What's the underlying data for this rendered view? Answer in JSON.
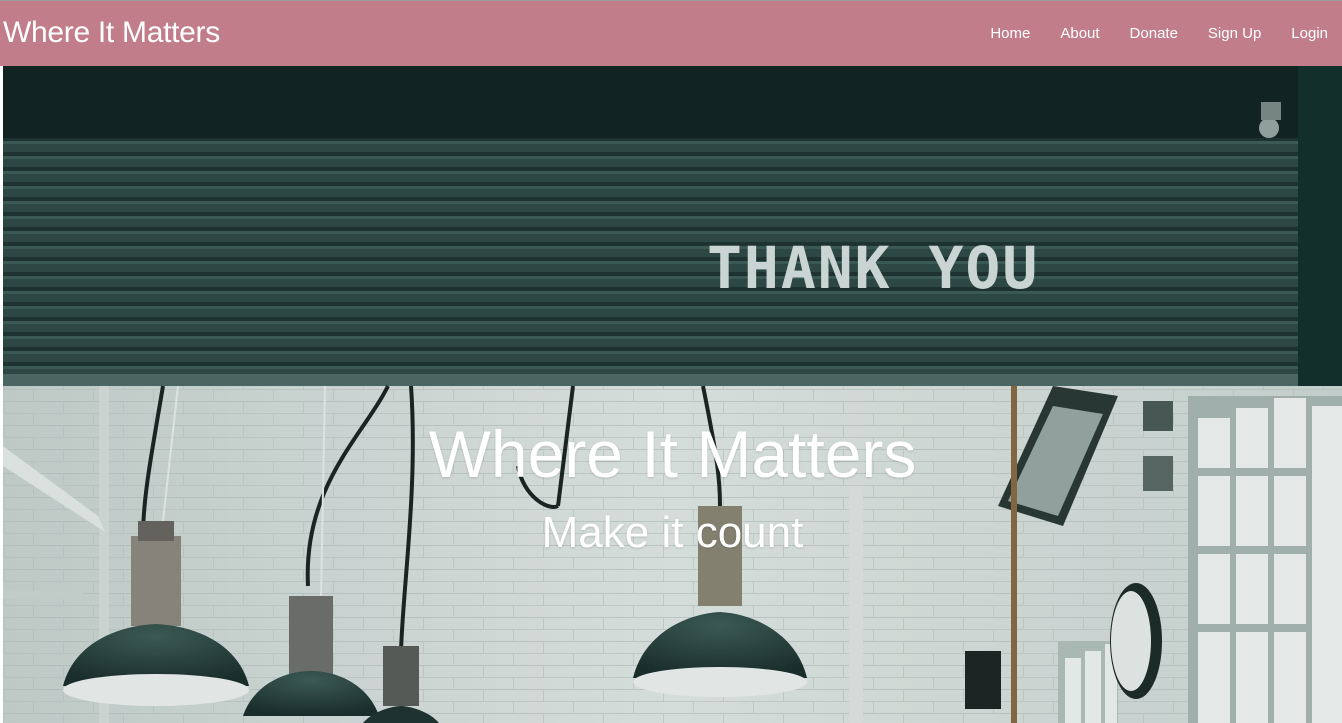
{
  "header": {
    "brand": "Where It Matters",
    "nav": [
      {
        "label": "Home"
      },
      {
        "label": "About"
      },
      {
        "label": "Donate"
      },
      {
        "label": "Sign Up"
      },
      {
        "label": "Login"
      }
    ],
    "background_color": "#c17e8a"
  },
  "hero": {
    "title": "Where It Matters",
    "subtitle": "Make it count",
    "image_sign_text": "THANK YOU"
  }
}
